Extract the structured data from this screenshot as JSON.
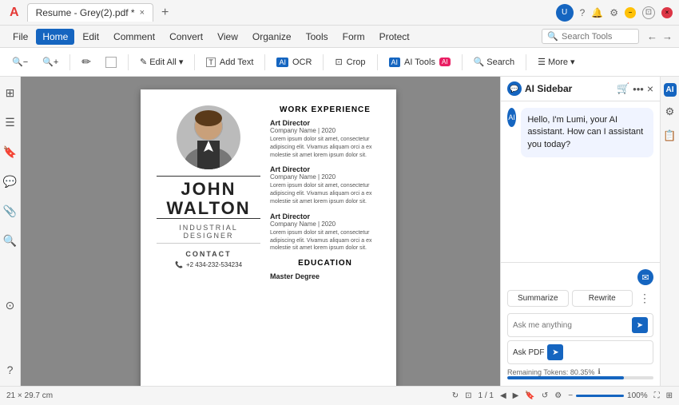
{
  "titleBar": {
    "tab": "Resume - Grey(2).pdf *",
    "closeTab": "×",
    "addTab": "+"
  },
  "menuBar": {
    "items": [
      "File",
      "Home",
      "Edit",
      "Comment",
      "Convert",
      "View",
      "Organize",
      "Tools",
      "Form",
      "Protect"
    ],
    "activeItem": "Home",
    "searchPlaceholder": "Search Tools"
  },
  "toolbar": {
    "editAll": "Edit All",
    "editDropdown": "▾",
    "addText": "Add Text",
    "ocr": "OCR",
    "crop": "Crop",
    "aiTools": "AI Tools",
    "aiBadge": "AI",
    "search": "Search",
    "more": "More",
    "moreDropdown": "▾",
    "zoomOut": "−",
    "zoomIn": "+",
    "highlight": "✏",
    "annotation": "□"
  },
  "leftSidebar": {
    "icons": [
      "⊞",
      "☰",
      "🔖",
      "💬",
      "📎",
      "🔍",
      "⊙"
    ]
  },
  "pdfContent": {
    "name": "JOHN\nWALTON",
    "title": "INDUSTRIAL DESIGNER",
    "contactLabel": "CONTACT",
    "phone": "+2 434-232-534234",
    "workExperience": "WORK EXPERIENCE",
    "education": "EDUCATION",
    "jobs": [
      {
        "title": "Art Director",
        "company": "Company Name  |  2020",
        "desc": "Lorem ipsum dolor sit amet, consectetur adipiscing elit. Vivamus aliquam orci a ex molestie sit amet lorem ipsum dolor sit."
      },
      {
        "title": "Art Director",
        "company": "Company Name  |  2020",
        "desc": "Lorem ipsum dolor sit amet, consectetur adipiscing elit. Vivamus aliquam orci a ex molestie sit amet lorem ipsum dolor sit."
      },
      {
        "title": "Art Director",
        "company": "Company Name  |  2020",
        "desc": "Lorem ipsum dolor sit amet, consectetur adipiscing elit. Vivamus aliquam orci a ex molestie sit amet lorem ipsum dolor sit."
      }
    ]
  },
  "aiSidebar": {
    "title": "AI Sidebar",
    "greeting": "Hello, I'm Lumi, your AI assistant. How can I assistant you today?",
    "summarizeBtn": "Summarize",
    "rewriteBtn": "Rewrite",
    "inputPlaceholder": "Ask me anything",
    "askPdfBtn": "Ask PDF",
    "tokensLabel": "Remaining Tokens: 80.35%",
    "tokenPct": 80
  },
  "statusBar": {
    "dimensions": "21 × 29.7 cm",
    "pageInfo": "1 / 1",
    "zoomLevel": "100%"
  }
}
